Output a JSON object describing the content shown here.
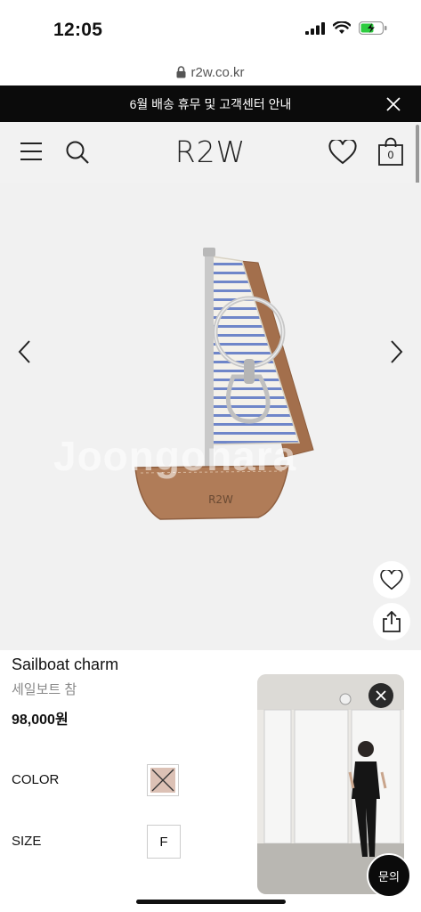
{
  "status_bar": {
    "time": "12:05"
  },
  "browser": {
    "url": "r2w.co.kr"
  },
  "announcement": {
    "text": "6월 배송 휴무 및 고객센터 안내"
  },
  "header": {
    "brand": "R2W",
    "cart_count": "0"
  },
  "hero": {
    "watermark": "Joongonara",
    "boat_logo": "R2W"
  },
  "product": {
    "name": "Sailboat charm",
    "name_ko": "세일보트 참",
    "price": "98,000원"
  },
  "options": {
    "color_label": "COLOR",
    "size_label": "SIZE",
    "size_value": "F"
  },
  "inquiry": {
    "label": "문의"
  },
  "colors": {
    "announce_bg": "#0b0b0b",
    "header_bg": "#f2f2f2",
    "swatch": "#dcc1b5"
  }
}
